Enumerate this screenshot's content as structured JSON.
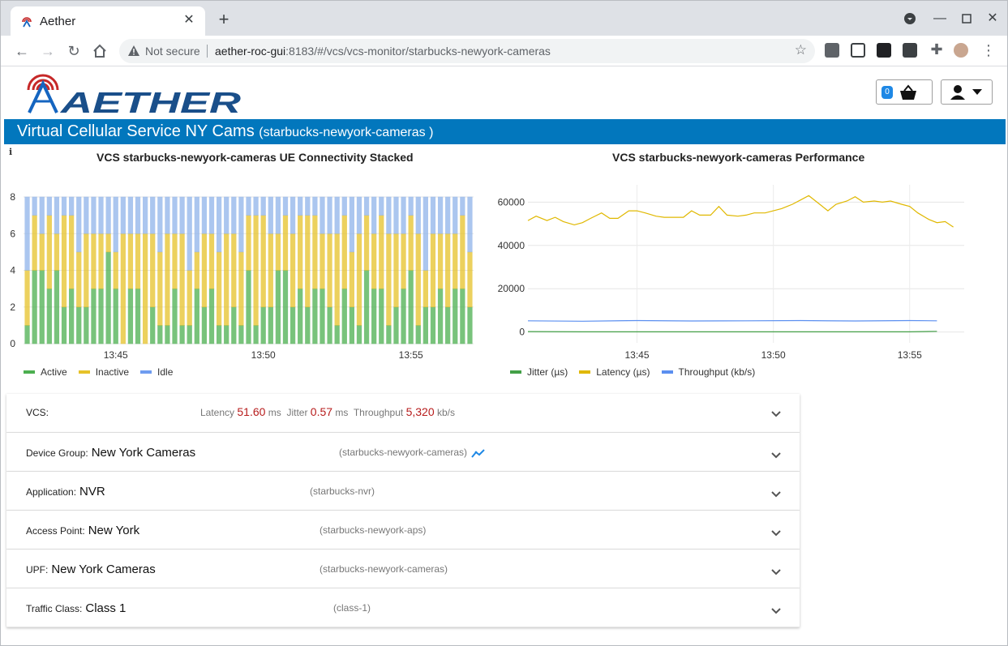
{
  "browser": {
    "tab_title": "Aether",
    "not_secure_label": "Not secure",
    "url_host": "aether-roc-gui",
    "url_rest": ":8183/#/vcs/vcs-monitor/starbucks-newyork-cameras"
  },
  "header": {
    "logo_text": "AETHER",
    "basket_count": "0"
  },
  "title": {
    "main": "Virtual Cellular Service NY Cams",
    "sub": "(starbucks-newyork-cameras )"
  },
  "info_icon": "i",
  "charts": {
    "left_title": "VCS starbucks-newyork-cameras UE Connectivity Stacked",
    "right_title": "VCS starbucks-newyork-cameras Performance"
  },
  "chart_data": [
    {
      "type": "bar",
      "stacked": true,
      "title": "VCS starbucks-newyork-cameras UE Connectivity Stacked",
      "ylim": [
        0,
        8
      ],
      "yticks": [
        "0",
        "2",
        "4",
        "6",
        "8"
      ],
      "xticks": [
        "13:45",
        "13:50",
        "13:55"
      ],
      "xtick_index": [
        12,
        32,
        52
      ],
      "series": [
        {
          "name": "Active",
          "color": "#4caf50",
          "values": [
            1,
            4,
            4,
            3,
            4,
            2,
            3,
            2,
            2,
            3,
            3,
            5,
            3,
            0,
            3,
            3,
            0,
            2,
            1,
            1,
            3,
            1,
            1,
            3,
            2,
            3,
            1,
            1,
            2,
            1,
            4,
            1,
            2,
            2,
            4,
            4,
            2,
            3,
            2,
            3,
            3,
            2,
            1,
            3,
            2,
            1,
            4,
            3,
            3,
            1,
            2,
            3,
            4,
            1,
            2,
            2,
            3,
            2,
            3,
            3,
            2
          ]
        },
        {
          "name": "Inactive",
          "color": "#e6c229",
          "values": [
            3,
            3,
            2,
            4,
            2,
            5,
            4,
            3,
            4,
            3,
            3,
            1,
            2,
            6,
            3,
            3,
            6,
            4,
            4,
            5,
            3,
            5,
            3,
            2,
            4,
            3,
            4,
            5,
            4,
            4,
            3,
            6,
            5,
            4,
            2,
            3,
            4,
            4,
            5,
            4,
            3,
            4,
            5,
            4,
            3,
            5,
            3,
            3,
            4,
            5,
            4,
            3,
            3,
            5,
            2,
            4,
            3,
            4,
            3,
            4,
            3
          ]
        },
        {
          "name": "Idle",
          "color": "#90b4ea",
          "values": [
            4,
            1,
            2,
            1,
            2,
            1,
            1,
            3,
            2,
            2,
            2,
            2,
            3,
            2,
            2,
            2,
            2,
            2,
            3,
            2,
            2,
            2,
            4,
            3,
            2,
            2,
            3,
            2,
            2,
            3,
            1,
            1,
            1,
            2,
            2,
            1,
            2,
            1,
            1,
            1,
            2,
            2,
            2,
            1,
            3,
            2,
            1,
            2,
            1,
            2,
            2,
            2,
            1,
            2,
            4,
            2,
            2,
            2,
            2,
            1,
            3
          ]
        }
      ]
    },
    {
      "type": "line",
      "title": "VCS starbucks-newyork-cameras Performance",
      "ylim": [
        -5000,
        68000
      ],
      "yticks": [
        0,
        20000,
        40000,
        60000
      ],
      "xticks": [
        "13:45",
        "13:50",
        "13:55"
      ],
      "x_range_minutes": [
        "13:41",
        "13:57"
      ],
      "series": [
        {
          "name": "Jitter (µs)",
          "color": "#43a047",
          "x": [
            "13:41",
            "13:43",
            "13:45",
            "13:47",
            "13:49",
            "13:51",
            "13:53",
            "13:55",
            "13:56"
          ],
          "values": [
            200,
            100,
            100,
            100,
            100,
            100,
            100,
            100,
            300
          ]
        },
        {
          "name": "Latency (µs)",
          "color": "#e0b800",
          "x": [
            "13:41",
            "13:41.3",
            "13:41.7",
            "13:42",
            "13:42.3",
            "13:42.7",
            "13:43",
            "13:43.3",
            "13:43.7",
            "13:44",
            "13:44.3",
            "13:44.7",
            "13:45",
            "13:45.3",
            "13:45.7",
            "13:46",
            "13:46.3",
            "13:46.7",
            "13:47",
            "13:47.3",
            "13:47.7",
            "13:48",
            "13:48.3",
            "13:48.7",
            "13:49",
            "13:49.3",
            "13:49.7",
            "13:50",
            "13:50.3",
            "13:50.7",
            "13:51",
            "13:51.3",
            "13:51.7",
            "13:52",
            "13:52.3",
            "13:52.7",
            "13:53",
            "13:53.3",
            "13:53.7",
            "13:54",
            "13:54.3",
            "13:54.7",
            "13:55",
            "13:55.3",
            "13:55.7",
            "13:56",
            "13:56.3",
            "13:56.6"
          ],
          "values": [
            51500,
            53500,
            51500,
            53000,
            51000,
            49500,
            50500,
            52500,
            55000,
            52500,
            52500,
            56000,
            56000,
            55000,
            53500,
            53000,
            53000,
            53000,
            56000,
            54000,
            54000,
            58000,
            54000,
            53500,
            54000,
            55000,
            55000,
            56000,
            57000,
            59000,
            61000,
            63000,
            59000,
            56000,
            59000,
            60500,
            62500,
            60000,
            60500,
            60000,
            60500,
            59000,
            58000,
            55000,
            52000,
            50500,
            51000,
            48500
          ]
        },
        {
          "name": "Throughput (kb/s)",
          "color": "#5b8ff0",
          "x": [
            "13:41",
            "13:43",
            "13:45",
            "13:47",
            "13:49",
            "13:51",
            "13:53",
            "13:55",
            "13:56"
          ],
          "values": [
            5200,
            5000,
            5300,
            5100,
            5200,
            5300,
            5100,
            5300,
            5200
          ]
        }
      ]
    }
  ],
  "legend_left": [
    "Active",
    "Inactive",
    "Idle"
  ],
  "legend_right": [
    "Jitter (µs)",
    "Latency (µs)",
    "Throughput (kb/s)"
  ],
  "vcs_row": {
    "label": "VCS:",
    "latency_label": "Latency",
    "latency_value": "51.60",
    "latency_unit": "ms",
    "jitter_label": "Jitter",
    "jitter_value": "0.57",
    "jitter_unit": "ms",
    "throughput_label": "Throughput",
    "throughput_value": "5,320",
    "throughput_unit": "kb/s"
  },
  "rows": [
    {
      "label": "Device Group:",
      "value": "New York Cameras",
      "ident": "(starbucks-newyork-cameras)"
    },
    {
      "label": "Application:",
      "value": "NVR",
      "ident": "(starbucks-nvr)"
    },
    {
      "label": "Access Point:",
      "value": "New York",
      "ident": "(starbucks-newyork-aps)"
    },
    {
      "label": "UPF:",
      "value": "New York Cameras",
      "ident": "(starbucks-newyork-cameras)"
    },
    {
      "label": "Traffic Class:",
      "value": "Class 1",
      "ident": "(class-1)"
    }
  ]
}
